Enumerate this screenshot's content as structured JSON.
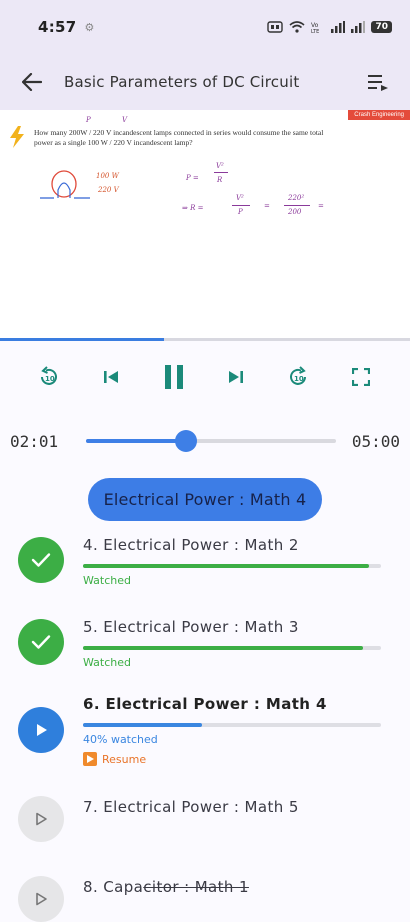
{
  "status_bar": {
    "time": "4:57",
    "battery": "70"
  },
  "app_bar": {
    "title": "Basic Parameters of DC Circuit"
  },
  "video": {
    "brand": "Crash Engineering",
    "question_line1": "How many 200W / 220 V incandescent lamps connected in series would consume the same total",
    "question_line2": "power as a single 100 W / 220 V incandescent lamp?",
    "note_top_p": "P",
    "note_top_v": "V",
    "note_lamp_1": "100 W",
    "note_lamp_2": "220 V",
    "note_p": "P =",
    "note_v2": "V²",
    "note_r": "R",
    "note_arrow": "⇒ R =",
    "note_v2b": "V²",
    "note_pb": "P",
    "note_eq": "=",
    "note_num": "220²",
    "note_den": "200",
    "note_eq2": "=",
    "playback_progress_pct": 40
  },
  "player": {
    "current_time": "02:01",
    "total_time": "05:00",
    "seek_progress_pct": 40
  },
  "now_playing": {
    "label": "Electrical Power : Math 4"
  },
  "playlist": [
    {
      "title": "4. Electrical Power : Math 2",
      "status": "Watched",
      "state": "watched",
      "progress_pct": 96,
      "color": "#3cae45"
    },
    {
      "title": "5. Electrical Power : Math 3",
      "status": "Watched",
      "state": "watched",
      "progress_pct": 94,
      "color": "#3cae45"
    },
    {
      "title": "6. Electrical Power : Math 4",
      "status": "40% watched",
      "state": "current",
      "progress_pct": 40,
      "color": "#3a86e0",
      "resume_label": "Resume"
    },
    {
      "title": "7. Electrical Power : Math 5",
      "status": "",
      "state": "locked",
      "progress_pct": 0,
      "color": "#c8c8c8"
    },
    {
      "title_prefix": "8. Capa",
      "title_struck": "citor : Math 1",
      "status": "",
      "state": "locked",
      "progress_pct": 0,
      "color": "#c8c8c8"
    }
  ],
  "colors": {
    "accent": "#3d7de6",
    "watched": "#3cae45",
    "resume": "#f08a2c",
    "bar_bg": "#ece8f6"
  }
}
